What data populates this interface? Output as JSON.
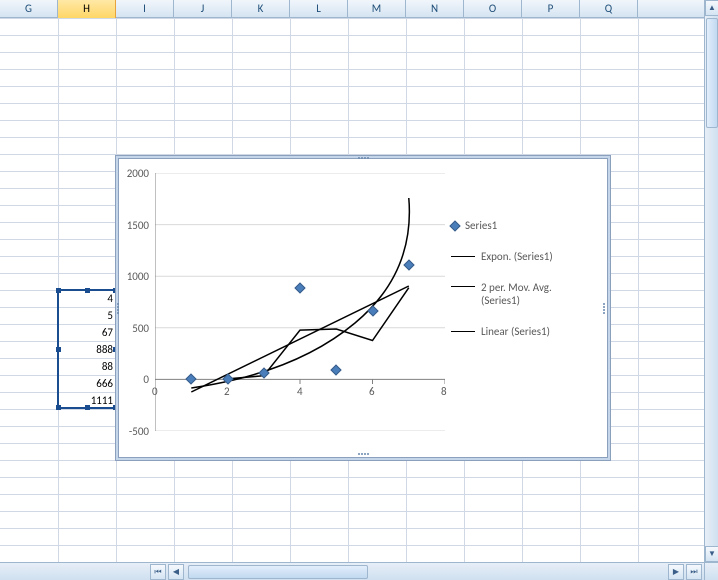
{
  "columns": [
    "G",
    "H",
    "I",
    "J",
    "K",
    "L",
    "M",
    "N",
    "O",
    "P",
    "Q"
  ],
  "selected_column": "H",
  "cells": [
    {
      "value": "4"
    },
    {
      "value": "5"
    },
    {
      "value": "67"
    },
    {
      "value": "888"
    },
    {
      "value": "88"
    },
    {
      "value": "666"
    },
    {
      "value": "1111"
    }
  ],
  "legend": {
    "series": "Series1",
    "expon": "Expon. (Series1)",
    "movavg_line1": "2 per. Mov. Avg.",
    "movavg_line2": "(Series1)",
    "linear": "Linear (Series1)"
  },
  "chart_data": {
    "type": "scatter",
    "x": [
      1,
      2,
      3,
      4,
      5,
      6,
      7
    ],
    "values": [
      4,
      5,
      67,
      888,
      88,
      666,
      1111
    ],
    "xlim": [
      0,
      8
    ],
    "ylim": [
      -500,
      2000
    ],
    "xticks": [
      0,
      2,
      4,
      6,
      8
    ],
    "yticks": [
      -500,
      0,
      500,
      1000,
      1500,
      2000
    ],
    "series_name": "Series1",
    "trendlines": [
      "Expon. (Series1)",
      "2 per. Mov. Avg. (Series1)",
      "Linear (Series1)"
    ]
  }
}
